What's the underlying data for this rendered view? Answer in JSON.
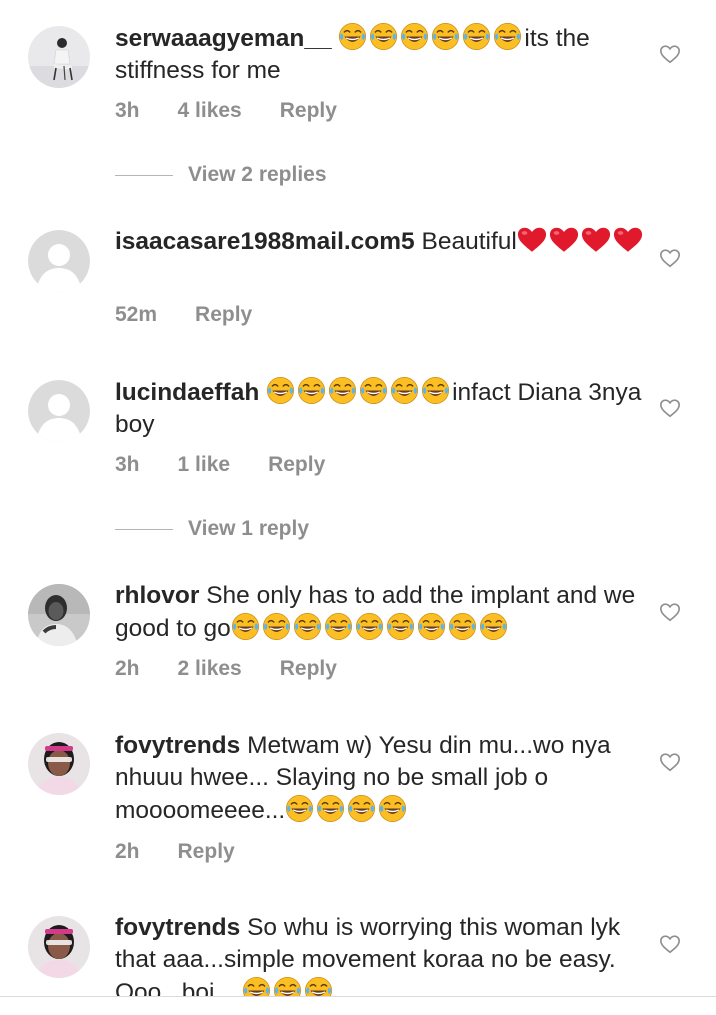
{
  "colors": {
    "text": "#262626",
    "meta": "#8e8e8e",
    "divider": "#dbdbdb",
    "heart_emoji": "#e0192c",
    "laugh_emoji": "#fbbf24"
  },
  "comments": [
    {
      "username": "serwaaagyeman__",
      "text_before": "",
      "text_after": "its the stiffness for me",
      "laugh_count": 6,
      "time": "3h",
      "likes": "4 likes",
      "reply_label": "Reply",
      "view_replies": "View 2 replies",
      "avatar": "photo-woman-sitting"
    },
    {
      "username": "isaacasare1988mail.com5",
      "text_before": "Beautiful",
      "heart_count": 4,
      "time": "52m",
      "likes": "",
      "reply_label": "Reply",
      "avatar": "default-avatar"
    },
    {
      "username": "lucindaeffah",
      "text_before": "",
      "text_after": "infact Diana 3nya boy",
      "laugh_count": 6,
      "time": "3h",
      "likes": "1 like",
      "reply_label": "Reply",
      "view_replies": "View 1 reply",
      "avatar": "default-avatar"
    },
    {
      "username": "rhlovor",
      "text_before": "She only has to add the implant and we good to go",
      "laugh_count": 9,
      "time": "2h",
      "likes": "2 likes",
      "reply_label": "Reply",
      "avatar": "photo-person"
    },
    {
      "username": "fovytrends",
      "text_before": "Metwam w)  Yesu din mu...wo nya nhuuu hwee... Slaying no be small job o moooomeeee...",
      "laugh_count": 4,
      "time": "2h",
      "likes": "",
      "reply_label": "Reply",
      "avatar": "photo-woman-headband"
    },
    {
      "username": "fovytrends",
      "text_before": "So whu is worrying this woman lyk that aaa...simple movement koraa no be easy. Ooo...boi....",
      "laugh_count": 3,
      "avatar": "photo-woman-headband"
    }
  ]
}
